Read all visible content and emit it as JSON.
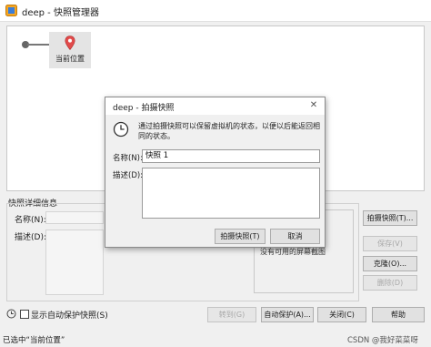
{
  "window": {
    "title": "deep - 快照管理器"
  },
  "tree": {
    "node_label": "当前位置"
  },
  "details": {
    "group_label": "快照详细信息",
    "name_label": "名称(N):",
    "desc_label": "描述(D):",
    "no_screenshot": "没有可用的屏幕截图"
  },
  "side_buttons": {
    "take": "拍摄快照(T)...",
    "save": "保存(V)",
    "clone": "克隆(O)...",
    "delete": "删除(D)"
  },
  "bottom": {
    "show_autoprotect": "显示自动保护快照(S)",
    "goto": "转到(G)",
    "autoprotect": "自动保护(A)...",
    "close": "关闭(C)",
    "help": "帮助"
  },
  "status": {
    "text": "已选中“当前位置”",
    "watermark": "CSDN @我好菜菜呀"
  },
  "dialog": {
    "title": "deep - 拍摄快照",
    "message": "通过拍摄快照可以保留虚拟机的状态，以便以后能返回相同的状态。",
    "name_label": "名称(N):",
    "name_value": "快照 1",
    "desc_label": "描述(D):",
    "take_button": "拍摄快照(T)",
    "cancel_button": "取消"
  }
}
